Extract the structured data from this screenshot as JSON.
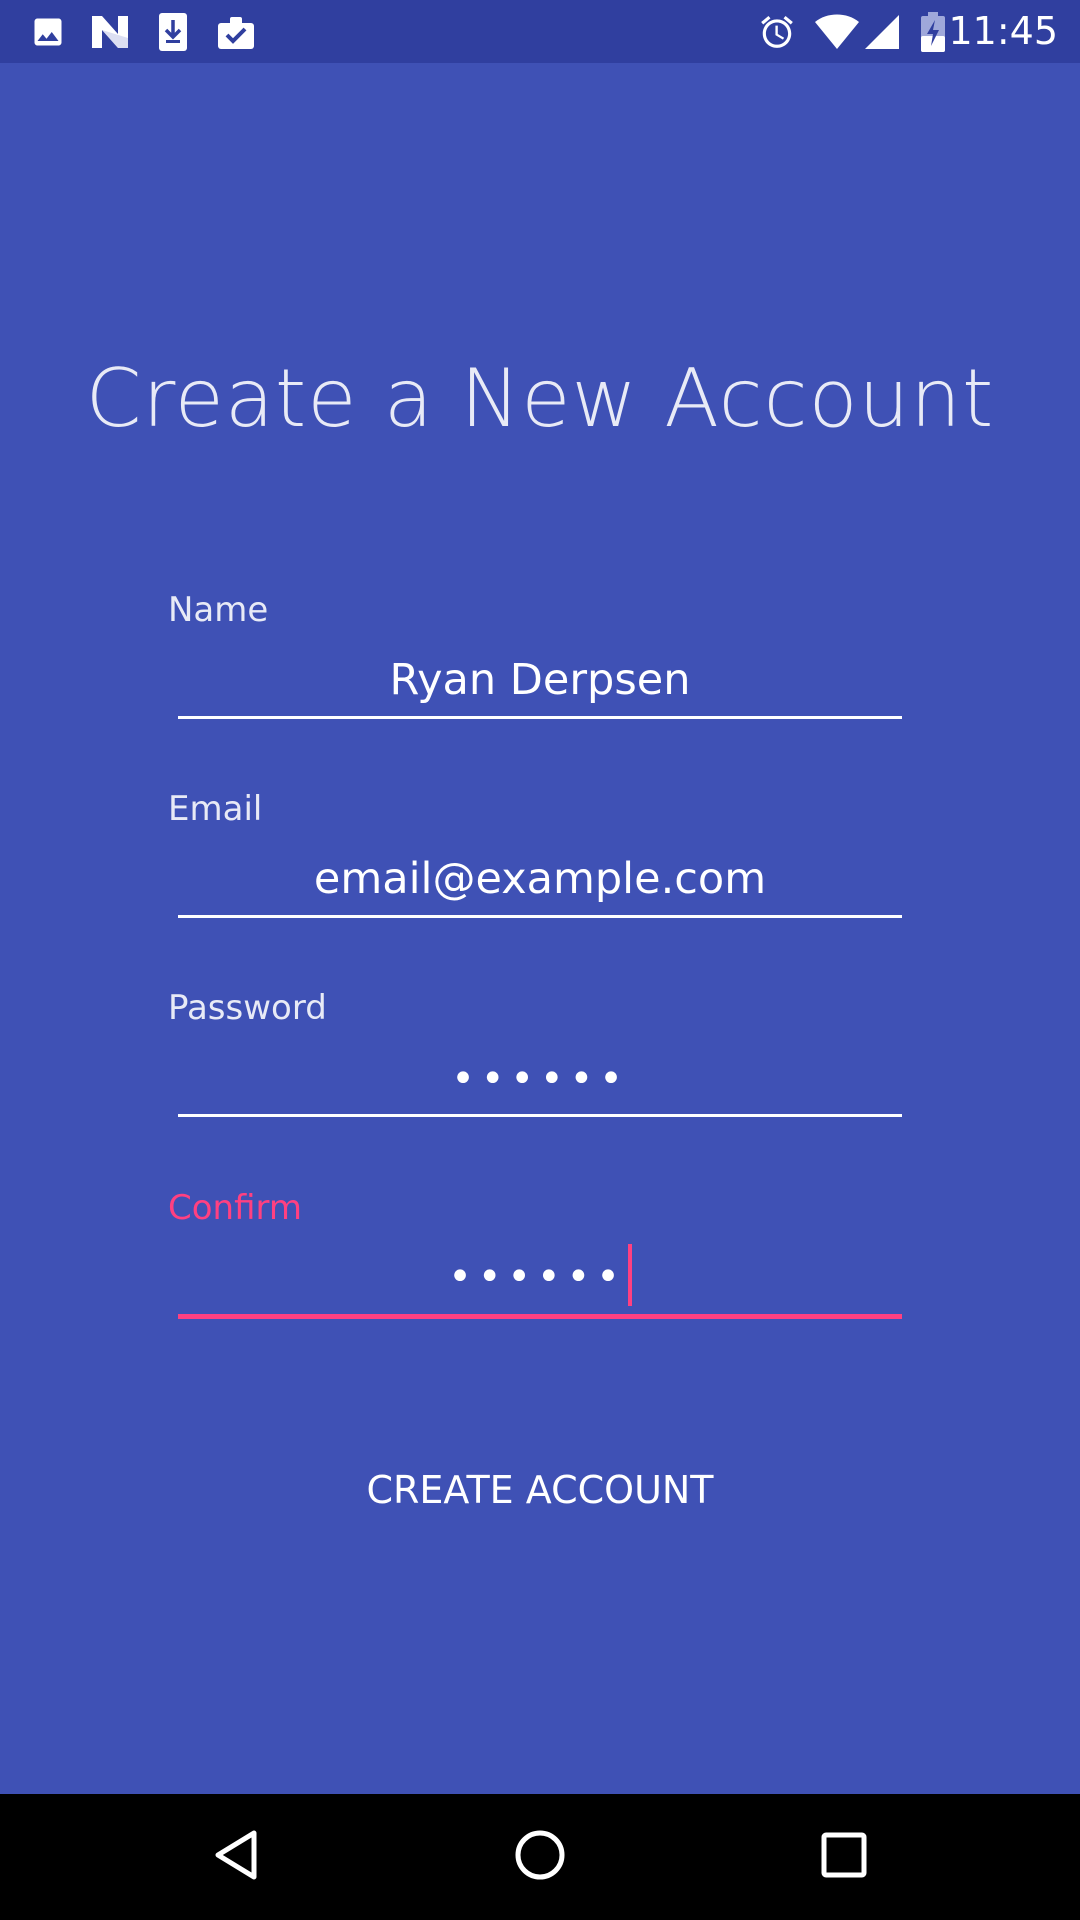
{
  "status_bar": {
    "time": "11:45",
    "left_icons": [
      "image-icon",
      "n-logo-icon",
      "download-icon",
      "clipboard-check-icon"
    ],
    "right_icons": [
      "alarm-icon",
      "wifi-icon",
      "signal-icon",
      "battery-charging-icon"
    ]
  },
  "title": "Create a New Account",
  "form": {
    "name": {
      "label": "Name",
      "value": "Ryan Derpsen"
    },
    "email": {
      "label": "Email",
      "value": "email@example.com"
    },
    "password": {
      "label": "Password",
      "value": "••••••"
    },
    "confirm": {
      "label": "Confirm",
      "value": "••••••"
    }
  },
  "button": {
    "label": "CREATE ACCOUNT"
  },
  "nav_bar": {
    "buttons": [
      "back-icon",
      "home-icon",
      "recents-icon"
    ]
  },
  "colors": {
    "background": "#3f51b5",
    "status_bar": "#303f9f",
    "accent": "#ff4081",
    "text": "#ffffff"
  }
}
